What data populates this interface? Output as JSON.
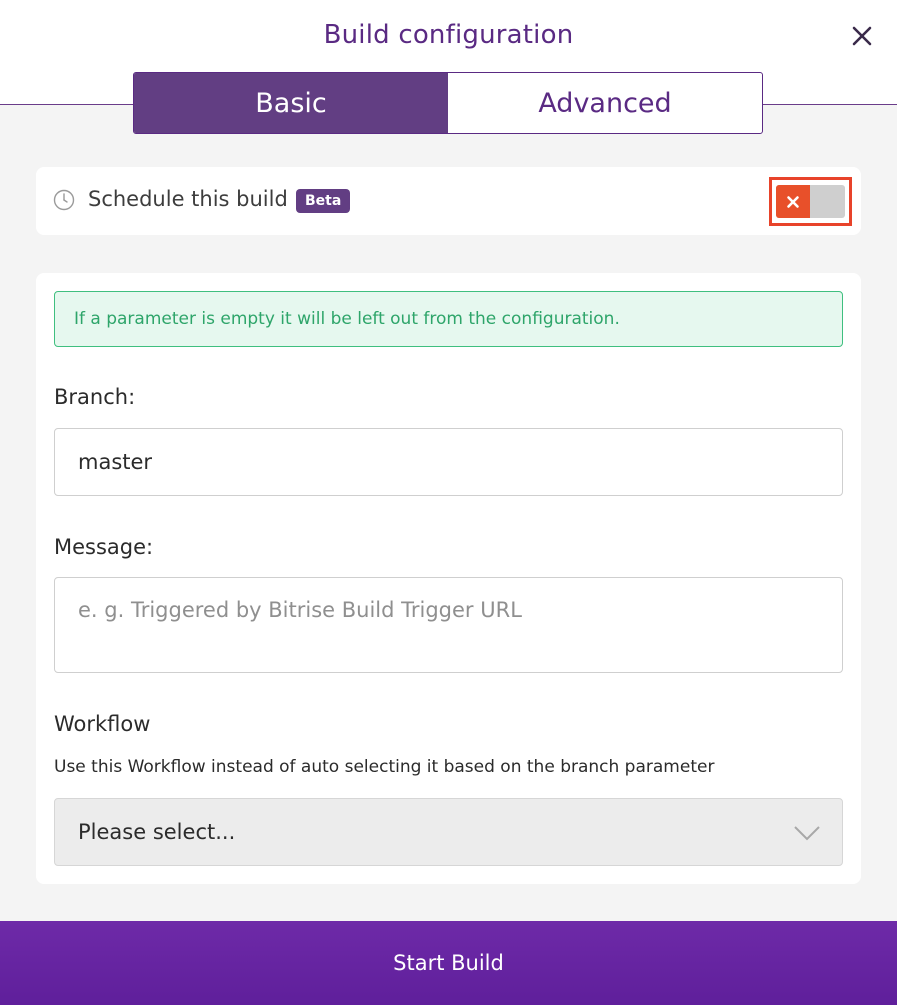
{
  "dialog": {
    "title": "Build configuration"
  },
  "tabs": [
    {
      "label": "Basic",
      "active": true
    },
    {
      "label": "Advanced",
      "active": false
    }
  ],
  "schedule": {
    "label": "Schedule this build",
    "badge": "Beta",
    "toggle_on": false
  },
  "notice": "If a parameter is empty it will be left out from the configuration.",
  "branch": {
    "label": "Branch:",
    "value": "master"
  },
  "message": {
    "label": "Message:",
    "placeholder": "e. g. Triggered by Bitrise Build Trigger URL"
  },
  "workflow": {
    "label": "Workflow",
    "helper": "Use this Workflow instead of auto selecting it based on the branch parameter",
    "selected": "Please select..."
  },
  "start_button": "Start Build",
  "colors": {
    "brand_purple": "#623e83",
    "toggle_off_accent": "#e8502a",
    "notice_green": "#2ea56a"
  }
}
